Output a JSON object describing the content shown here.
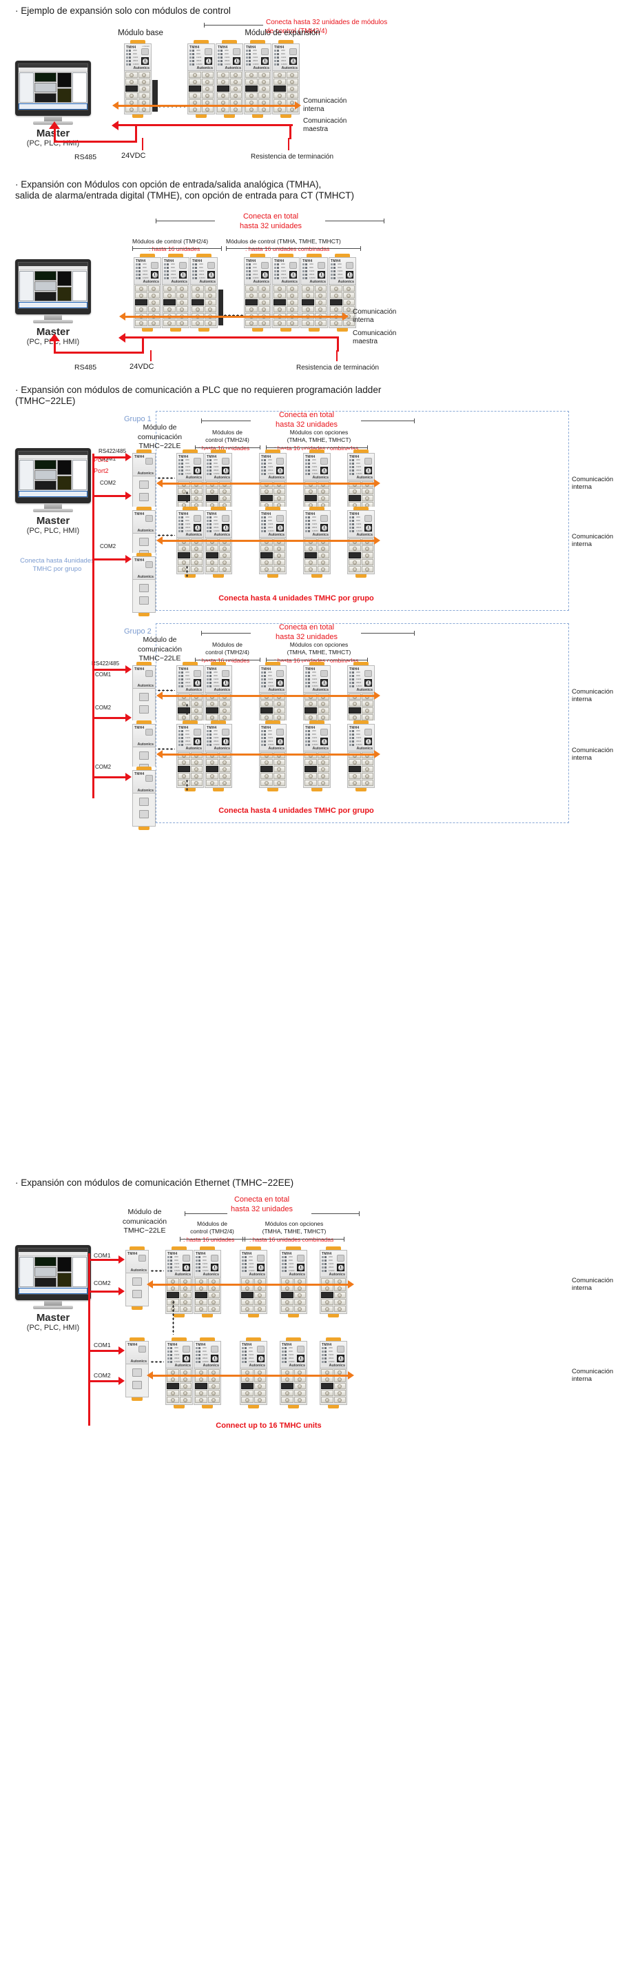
{
  "doc": {
    "brand": "Autonics",
    "model_label": "TMH4",
    "loader_label": "LOADER",
    "addr_label": "ADDR",
    "baud_rates": [
      "4800",
      "9600",
      "19200",
      "38400",
      "115200"
    ],
    "ch_labels": [
      "PWR",
      "CH1",
      "CH2",
      "CH3",
      "CH4"
    ],
    "colors": {
      "red": "#e8131a",
      "orange": "#f07a1a",
      "blue": "#7b9bd0",
      "grey": "#4a4a4a",
      "tab_orange": "#f0a429"
    }
  },
  "master": {
    "name": "Master",
    "sub": "(PC, PLC, HMI)"
  },
  "sections": [
    {
      "id": "s1",
      "title": "· Ejemplo de expansión solo con módulos de control",
      "callout_top": "Conecta hasta 32 unidades de módulos\nde control (TMH2/4)",
      "label_base": "Módulo base",
      "label_expansion": "Módulo de expansión",
      "label_internal_comm": "Comunicación\ninterna",
      "label_master_comm": "Comunicación\nmaestra",
      "label_rs485": "RS485",
      "label_24vdc": "24VDC",
      "label_terminator": "Resistencia de terminación"
    },
    {
      "id": "s2",
      "title": "· Expansión con Módulos con opción de entrada/salida analógica (TMHA),\n  salida de alarma/entrada digital (TMHE), con opción de entrada para CT (TMHCT)",
      "callout_total": "Conecta en total\nhasta 32 unidades",
      "group_left_title": "Módulos de control (TMH2/4)",
      "group_left_value": ": hasta 16 unidades",
      "group_right_title": "Módulos de control (TMHA, TMHE, TMHCT)",
      "group_right_value": ": hasta 16 unidades combinadas",
      "label_internal_comm": "Comunicación\ninterna",
      "label_master_comm": "Comunicación\nmaestra",
      "label_rs485": "RS485",
      "label_24vdc": "24VDC",
      "label_terminator": "Resistencia de terminación"
    },
    {
      "id": "s3",
      "title": "· Expansión con módulos de comunicación a PLC que no requieren programación ladder\n  (TMHC−22LE)",
      "group1_label": "Grupo 1",
      "group2_label": "Grupo 2",
      "comm_module_label": "Módulo de\ncomunicación\nTMHC−22LE",
      "callout_total": "Conecta en total\nhasta 32 unidades",
      "ctrl_modules_label": "Módulos de\ncontrol (TMH2/4)",
      "ctrl_modules_value": ": hasta 16 unidades",
      "opt_modules_label": "Módulos con opciones\n(TMHA, TMHE, TMHCT)",
      "opt_modules_value": ": hasta 16 unidades combinadas",
      "port1": "Port1",
      "port2": "Port2",
      "com1": "COM1",
      "com2": "COM2",
      "rs422_485": "RS422/485",
      "internal_comm": "Comunicación\ninterna",
      "note_per_group": "Conecta hasta 4 unidades TMHC por grupo",
      "note_per_group2": "Conecta hasta 4 unidades TMHC por grupo",
      "side_note": "Conecta hasta 4unidades\nTMHC por grupo"
    },
    {
      "id": "s4",
      "title": "· Expansión con módulos de comunicación Ethernet (TMHC−22EE)",
      "callout_total": "Conecta en total\nhasta 32 unidades",
      "comm_module_label": "Módulo de\ncomunicación\nTMHC−22LE",
      "ctrl_modules_label": "Módulos de\ncontrol (TMH2/4)",
      "ctrl_modules_value": ": hasta 16 unidades",
      "opt_modules_label": "Módulos con opciones\n(TMHA, TMHE, TMHCT)",
      "opt_modules_value": ": hasta 16 unidades combinadas",
      "com1": "COM1",
      "com2": "COM2",
      "internal_comm": "Comunicación\ninterna",
      "bottom_note": "Connect up to 16 TMHC units"
    }
  ]
}
